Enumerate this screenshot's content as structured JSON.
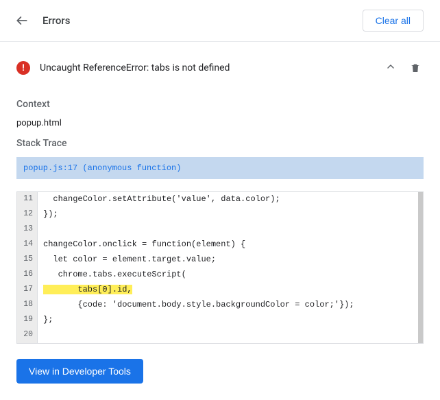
{
  "header": {
    "title": "Errors",
    "clear_all_label": "Clear all"
  },
  "error": {
    "badge_glyph": "!",
    "message": "Uncaught ReferenceError: tabs is not defined"
  },
  "context": {
    "label": "Context",
    "value": "popup.html"
  },
  "stack": {
    "label": "Stack Trace",
    "location": "popup.js:17",
    "fn": "(anonymous function)"
  },
  "code": {
    "lines": [
      {
        "n": 11,
        "text": "  changeColor.setAttribute('value', data.color);",
        "hl": false
      },
      {
        "n": 12,
        "text": "});",
        "hl": false
      },
      {
        "n": 13,
        "text": "",
        "hl": false
      },
      {
        "n": 14,
        "text": "changeColor.onclick = function(element) {",
        "hl": false
      },
      {
        "n": 15,
        "text": "  let color = element.target.value;",
        "hl": false
      },
      {
        "n": 16,
        "text": "   chrome.tabs.executeScript(",
        "hl": false
      },
      {
        "n": 17,
        "text": "       tabs[0].id,",
        "hl": true
      },
      {
        "n": 18,
        "text": "       {code: 'document.body.style.backgroundColor = color;'});",
        "hl": false
      },
      {
        "n": 19,
        "text": "};",
        "hl": false
      },
      {
        "n": 20,
        "text": "",
        "hl": false
      }
    ]
  },
  "footer": {
    "view_btn_label": "View in Developer Tools"
  }
}
